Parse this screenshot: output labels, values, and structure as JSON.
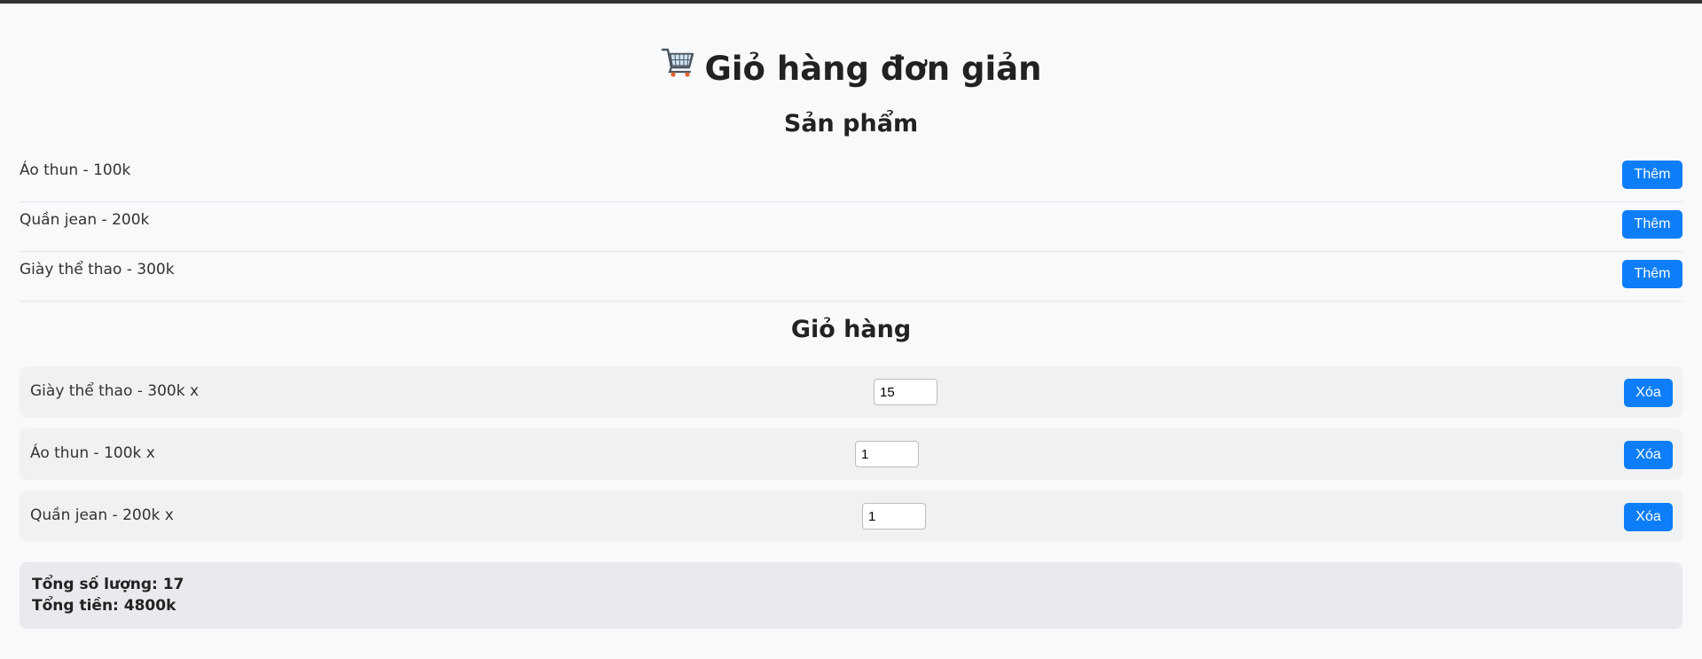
{
  "header": {
    "title": "Giỏ hàng đơn giản",
    "icon": "shopping-cart-icon"
  },
  "products_section": {
    "title": "Sản phẩm",
    "items": [
      {
        "label": "Áo thun - 100k",
        "button_label": "Thêm"
      },
      {
        "label": "Quần jean - 200k",
        "button_label": "Thêm"
      },
      {
        "label": "Giày thể thao - 300k",
        "button_label": "Thêm"
      }
    ]
  },
  "cart_section": {
    "title": "Giỏ hàng",
    "items": [
      {
        "label": "Giày thể thao - 300k x",
        "quantity": "15",
        "button_label": "Xóa"
      },
      {
        "label": "Áo thun - 100k x",
        "quantity": "1",
        "button_label": "Xóa"
      },
      {
        "label": "Quần jean - 200k x",
        "quantity": "1",
        "button_label": "Xóa"
      }
    ]
  },
  "summary": {
    "total_quantity": "Tổng số lượng: 17",
    "total_price": "Tổng tiền: 4800k"
  },
  "colors": {
    "accent": "#0d7ef8",
    "background": "#f8f9fb",
    "row_background": "#f0f1f3",
    "summary_background": "#e8eaed"
  }
}
